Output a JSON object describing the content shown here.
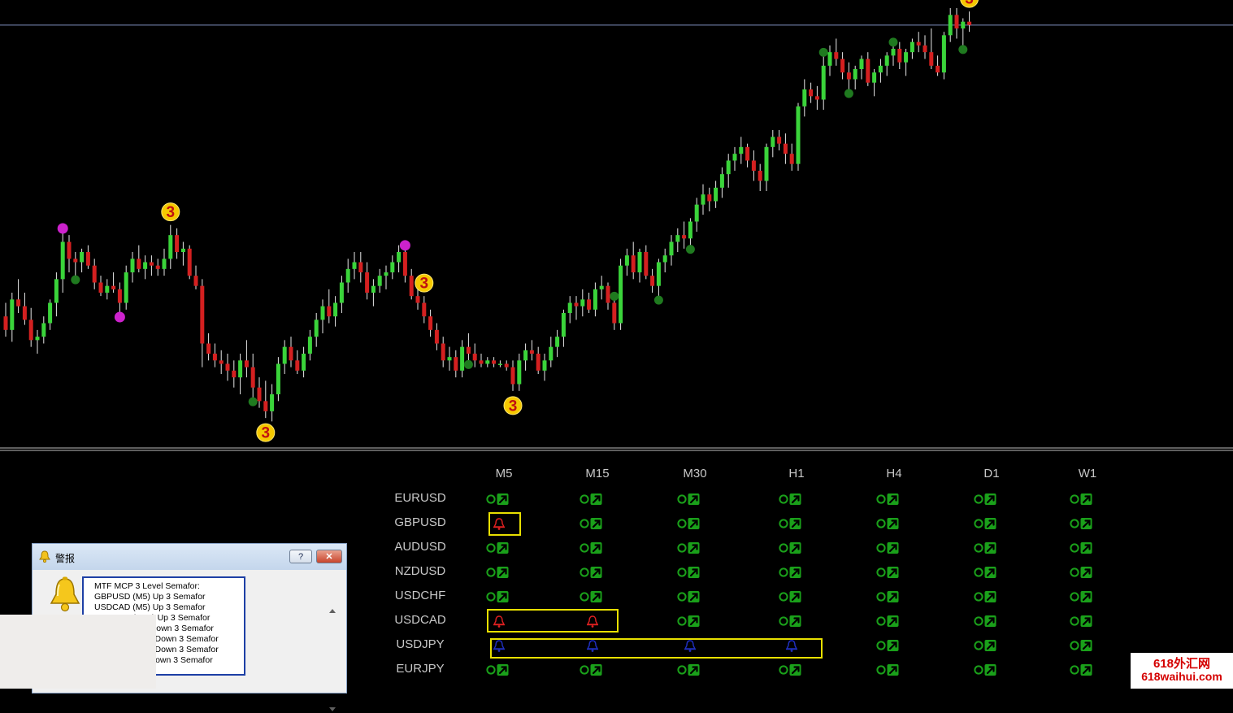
{
  "chart_data": {
    "type": "candlestick",
    "title": "",
    "candles": [
      [
        70,
        78,
        58,
        62
      ],
      [
        62,
        84,
        55,
        80
      ],
      [
        80,
        92,
        72,
        76
      ],
      [
        76,
        84,
        65,
        68
      ],
      [
        68,
        75,
        52,
        56
      ],
      [
        56,
        62,
        48,
        58
      ],
      [
        58,
        70,
        54,
        66
      ],
      [
        66,
        80,
        62,
        78
      ],
      [
        78,
        96,
        70,
        92
      ],
      [
        92,
        120,
        84,
        114
      ],
      [
        114,
        118,
        96,
        104
      ],
      [
        104,
        108,
        94,
        102
      ],
      [
        102,
        110,
        96,
        108
      ],
      [
        108,
        112,
        98,
        100
      ],
      [
        100,
        104,
        86,
        90
      ],
      [
        90,
        94,
        82,
        84
      ],
      [
        84,
        92,
        80,
        88
      ],
      [
        88,
        96,
        84,
        86
      ],
      [
        86,
        90,
        72,
        78
      ],
      [
        78,
        100,
        74,
        96
      ],
      [
        96,
        108,
        90,
        104
      ],
      [
        104,
        112,
        96,
        98
      ],
      [
        98,
        106,
        92,
        102
      ],
      [
        102,
        106,
        94,
        100
      ],
      [
        100,
        104,
        94,
        98
      ],
      [
        98,
        110,
        94,
        104
      ],
      [
        104,
        124,
        98,
        118
      ],
      [
        118,
        122,
        104,
        108
      ],
      [
        108,
        114,
        100,
        110
      ],
      [
        110,
        112,
        92,
        94
      ],
      [
        94,
        100,
        86,
        88
      ],
      [
        88,
        92,
        40,
        54
      ],
      [
        54,
        60,
        44,
        48
      ],
      [
        48,
        54,
        40,
        44
      ],
      [
        44,
        50,
        36,
        42
      ],
      [
        42,
        48,
        32,
        38
      ],
      [
        38,
        44,
        28,
        34
      ],
      [
        34,
        48,
        24,
        44
      ],
      [
        44,
        56,
        34,
        40
      ],
      [
        40,
        48,
        22,
        28
      ],
      [
        28,
        34,
        16,
        20
      ],
      [
        20,
        32,
        10,
        14
      ],
      [
        14,
        30,
        8,
        24
      ],
      [
        24,
        46,
        20,
        42
      ],
      [
        42,
        56,
        36,
        52
      ],
      [
        52,
        58,
        40,
        44
      ],
      [
        44,
        50,
        36,
        38
      ],
      [
        38,
        52,
        34,
        48
      ],
      [
        48,
        62,
        44,
        58
      ],
      [
        58,
        72,
        52,
        68
      ],
      [
        68,
        80,
        60,
        76
      ],
      [
        76,
        86,
        66,
        70
      ],
      [
        70,
        82,
        64,
        78
      ],
      [
        78,
        94,
        72,
        90
      ],
      [
        90,
        104,
        84,
        98
      ],
      [
        98,
        108,
        92,
        102
      ],
      [
        102,
        108,
        90,
        96
      ],
      [
        96,
        102,
        80,
        84
      ],
      [
        84,
        92,
        76,
        88
      ],
      [
        88,
        98,
        84,
        94
      ],
      [
        94,
        100,
        86,
        96
      ],
      [
        96,
        106,
        92,
        102
      ],
      [
        102,
        112,
        96,
        108
      ],
      [
        108,
        110,
        90,
        94
      ],
      [
        94,
        98,
        80,
        82
      ],
      [
        82,
        88,
        74,
        78
      ],
      [
        78,
        82,
        66,
        70
      ],
      [
        70,
        74,
        58,
        62
      ],
      [
        62,
        66,
        50,
        54
      ],
      [
        54,
        58,
        40,
        44
      ],
      [
        44,
        52,
        38,
        46
      ],
      [
        46,
        50,
        34,
        38
      ],
      [
        38,
        56,
        34,
        52
      ],
      [
        52,
        60,
        44,
        48
      ],
      [
        48,
        54,
        40,
        44
      ],
      [
        44,
        48,
        40,
        42
      ],
      [
        42,
        46,
        40,
        44
      ],
      [
        44,
        46,
        40,
        42
      ],
      [
        42,
        44,
        40,
        42
      ],
      [
        42,
        44,
        38,
        40
      ],
      [
        40,
        44,
        26,
        30
      ],
      [
        30,
        48,
        26,
        44
      ],
      [
        44,
        54,
        38,
        50
      ],
      [
        50,
        56,
        44,
        48
      ],
      [
        48,
        52,
        36,
        38
      ],
      [
        38,
        48,
        32,
        44
      ],
      [
        44,
        58,
        40,
        52
      ],
      [
        52,
        62,
        46,
        58
      ],
      [
        58,
        74,
        52,
        72
      ],
      [
        72,
        82,
        66,
        78
      ],
      [
        78,
        82,
        68,
        76
      ],
      [
        76,
        86,
        70,
        80
      ],
      [
        80,
        84,
        72,
        74
      ],
      [
        74,
        90,
        70,
        86
      ],
      [
        86,
        94,
        80,
        88
      ],
      [
        88,
        90,
        74,
        78
      ],
      [
        78,
        80,
        62,
        66
      ],
      [
        66,
        104,
        62,
        100
      ],
      [
        100,
        110,
        94,
        106
      ],
      [
        106,
        114,
        92,
        96
      ],
      [
        96,
        110,
        90,
        108
      ],
      [
        108,
        112,
        92,
        94
      ],
      [
        94,
        98,
        84,
        88
      ],
      [
        88,
        104,
        82,
        102
      ],
      [
        102,
        110,
        96,
        106
      ],
      [
        106,
        118,
        100,
        114
      ],
      [
        114,
        122,
        108,
        118
      ],
      [
        118,
        126,
        110,
        116
      ],
      [
        116,
        128,
        112,
        126
      ],
      [
        126,
        140,
        120,
        136
      ],
      [
        136,
        148,
        130,
        142
      ],
      [
        142,
        146,
        132,
        138
      ],
      [
        138,
        150,
        134,
        146
      ],
      [
        146,
        158,
        140,
        154
      ],
      [
        154,
        166,
        146,
        162
      ],
      [
        162,
        170,
        156,
        166
      ],
      [
        166,
        176,
        160,
        170
      ],
      [
        170,
        172,
        158,
        162
      ],
      [
        162,
        168,
        150,
        156
      ],
      [
        156,
        160,
        144,
        150
      ],
      [
        150,
        172,
        144,
        170
      ],
      [
        170,
        180,
        164,
        176
      ],
      [
        176,
        180,
        168,
        172
      ],
      [
        172,
        178,
        160,
        166
      ],
      [
        166,
        172,
        156,
        160
      ],
      [
        160,
        196,
        156,
        194
      ],
      [
        194,
        210,
        188,
        204
      ],
      [
        204,
        208,
        196,
        200
      ],
      [
        200,
        206,
        192,
        198
      ],
      [
        198,
        224,
        192,
        218
      ],
      [
        218,
        230,
        212,
        226
      ],
      [
        226,
        234,
        218,
        222
      ],
      [
        222,
        226,
        210,
        214
      ],
      [
        214,
        220,
        204,
        210
      ],
      [
        210,
        218,
        204,
        216
      ],
      [
        216,
        224,
        210,
        222
      ],
      [
        222,
        226,
        206,
        208
      ],
      [
        208,
        216,
        200,
        214
      ],
      [
        214,
        222,
        208,
        218
      ],
      [
        218,
        226,
        212,
        224
      ],
      [
        224,
        230,
        218,
        228
      ],
      [
        228,
        232,
        216,
        220
      ],
      [
        220,
        228,
        212,
        226
      ],
      [
        226,
        234,
        222,
        232
      ],
      [
        232,
        238,
        226,
        230
      ],
      [
        230,
        236,
        222,
        226
      ],
      [
        226,
        240,
        216,
        218
      ],
      [
        218,
        224,
        212,
        214
      ],
      [
        214,
        238,
        210,
        236
      ],
      [
        236,
        252,
        232,
        248
      ],
      [
        248,
        252,
        234,
        240
      ],
      [
        240,
        246,
        230,
        244
      ],
      [
        244,
        250,
        238,
        242
      ]
    ],
    "horizontal_line": 242,
    "semafor_markers": [
      {
        "candle": 9,
        "level": "2",
        "position": "high",
        "color": "#cc22cc"
      },
      {
        "candle": 18,
        "level": "2",
        "position": "low",
        "color": "#cc22cc"
      },
      {
        "candle": 11,
        "level": "1",
        "position": "low",
        "color": "#1f7a1f"
      },
      {
        "candle": 26,
        "level": "3",
        "position": "high",
        "color": "#f5c800"
      },
      {
        "candle": 41,
        "level": "3",
        "position": "low",
        "color": "#f5c800"
      },
      {
        "candle": 39,
        "level": "1",
        "position": "low",
        "color": "#1f7a1f"
      },
      {
        "candle": 63,
        "level": "2",
        "position": "high",
        "color": "#cc22cc"
      },
      {
        "candle": 66,
        "level": "3",
        "position": "high",
        "color": "#f5c800"
      },
      {
        "candle": 80,
        "level": "3",
        "position": "low",
        "color": "#f5c800"
      },
      {
        "candle": 73,
        "level": "1",
        "position": "low",
        "color": "#1f7a1f"
      },
      {
        "candle": 96,
        "level": "1",
        "position": "high",
        "color": "#1f7a1f"
      },
      {
        "candle": 103,
        "level": "1",
        "position": "low",
        "color": "#1f7a1f"
      },
      {
        "candle": 108,
        "level": "1",
        "position": "low",
        "color": "#1f7a1f"
      },
      {
        "candle": 129,
        "level": "1",
        "position": "high",
        "color": "#1f7a1f"
      },
      {
        "candle": 133,
        "level": "1",
        "position": "low",
        "color": "#1f7a1f"
      },
      {
        "candle": 140,
        "level": "1",
        "position": "high",
        "color": "#1f7a1f"
      },
      {
        "candle": 151,
        "level": "1",
        "position": "low",
        "color": "#1f7a1f"
      },
      {
        "candle": 152,
        "level": "3",
        "position": "high",
        "color": "#f5c800"
      }
    ],
    "colors": {
      "up": "#3ad43a",
      "down": "#d42020",
      "wick": "#e8e8e8",
      "hline": "#8090c0",
      "separator": "#bcbcbc"
    }
  },
  "dashboard": {
    "timeframes": [
      "M5",
      "M15",
      "M30",
      "H1",
      "H4",
      "D1",
      "W1"
    ],
    "pairs": [
      {
        "name": "EURUSD",
        "signals": [
          "up",
          "up",
          "up",
          "up",
          "up",
          "up",
          "up"
        ]
      },
      {
        "name": "GBPUSD",
        "signals": [
          "alert-red",
          "up",
          "up",
          "up",
          "up",
          "up",
          "up"
        ]
      },
      {
        "name": "AUDUSD",
        "signals": [
          "up",
          "up",
          "up",
          "up",
          "up",
          "up",
          "up"
        ]
      },
      {
        "name": "NZDUSD",
        "signals": [
          "up",
          "up",
          "up",
          "up",
          "up",
          "up",
          "up"
        ]
      },
      {
        "name": "USDCHF",
        "signals": [
          "up",
          "up",
          "up",
          "up",
          "up",
          "up",
          "up"
        ]
      },
      {
        "name": "USDCAD",
        "signals": [
          "alert-red",
          "alert-red",
          "up",
          "up",
          "up",
          "up",
          "up"
        ]
      },
      {
        "name": "USDJPY",
        "signals": [
          "alert-blue",
          "alert-blue",
          "alert-blue",
          "alert-blue",
          "up",
          "up",
          "up"
        ]
      },
      {
        "name": "EURJPY",
        "signals": [
          "up",
          "up",
          "up",
          "up",
          "up",
          "up",
          "up"
        ]
      }
    ],
    "colors": {
      "up": "#1aa01a",
      "alert_red": "#e02020",
      "alert_blue": "#2030c0",
      "highlight": "#e8e000"
    }
  },
  "alert_window": {
    "title": "警报",
    "help_label": "?",
    "close_label": "✕",
    "icon": "bell-icon",
    "lines": [
      "MTF MCP 3 Level Semafor:",
      "GBPUSD (M5) Up 3 Semafor",
      "USDCAD (M5) Up 3 Semafor",
      "USDCAD (M15) Up 3 Semafor",
      "USDJPY (M5) Down 3 Semafor",
      "USDJPY (M15) Down 3 Semafor",
      "USDJPY (M30) Down 3 Semafor",
      "USDJPY (H1) Down 3 Semafor"
    ]
  },
  "watermark": {
    "line1": "618外汇网",
    "line2": "618waihui.com"
  }
}
